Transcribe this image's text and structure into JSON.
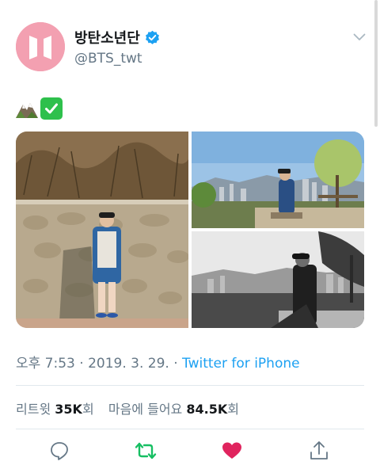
{
  "profile": {
    "display_name": "방탄소년단",
    "handle": "@BTS_twt",
    "verified": true,
    "avatar_color": "#f3a0b1"
  },
  "tweet": {
    "emojis": [
      "mountain-emoji",
      "white-check-mark-emoji"
    ]
  },
  "media": [
    {
      "icon": "photo-wall"
    },
    {
      "icon": "photo-city-view"
    },
    {
      "icon": "photo-city-bw"
    }
  ],
  "meta": {
    "time": "오후 7:53",
    "sep1": " · ",
    "date": "2019. 3. 29.",
    "sep2": " · ",
    "source": "Twitter for iPhone"
  },
  "stats": {
    "retweets_label": "리트윗",
    "retweets_value": "35K",
    "retweets_unit": "회",
    "likes_label": "마음에 들어요",
    "likes_value": "84.5K",
    "likes_unit": "회"
  },
  "colors": {
    "link": "#1da1f2",
    "retweet_active": "#17bf63",
    "like_active": "#e0245e",
    "secondary_text": "#657786"
  }
}
